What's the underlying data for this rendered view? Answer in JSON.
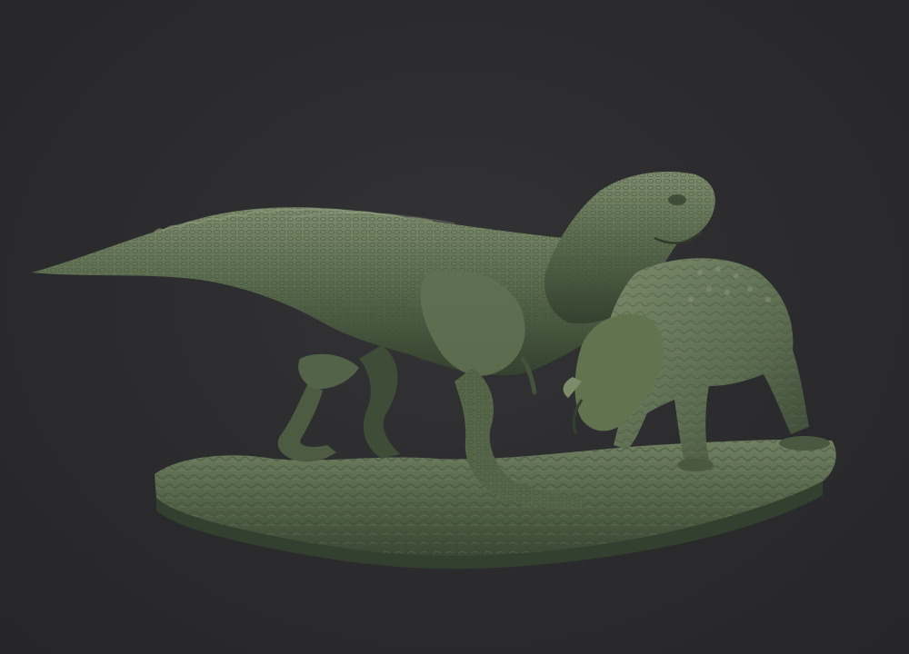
{
  "scene": {
    "background_color": "#2a2a2c",
    "model_color": "#5a6b4e",
    "model_shadow_color": "#2f3a2a",
    "model_highlight_color": "#8a9a78"
  }
}
